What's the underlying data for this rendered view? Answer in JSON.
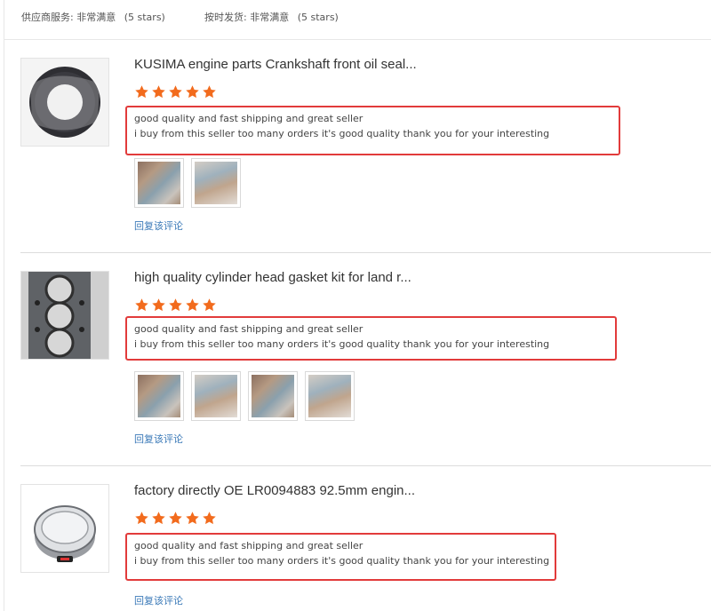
{
  "ratings": {
    "supplier_service_label": "供应商服务:",
    "supplier_service_value": "非常满意",
    "supplier_service_stars": "(5 stars)",
    "ship_on_time_label": "按时发货:",
    "ship_on_time_value": "非常满意",
    "ship_on_time_stars": "(5 stars)"
  },
  "colors": {
    "star": "#f26b1d",
    "highlight_border": "#e23b3b",
    "reply_link": "#3b7ab8"
  },
  "reviews": [
    {
      "title": "KUSIMA engine parts Crankshaft front oil seal...",
      "rating": 5,
      "comment_line1": "good quality and fast shipping and great seller",
      "comment_line2": "i buy from this seller too many orders it's good quality thank you for your interesting",
      "photo_count": 2,
      "reply_label": "回复该评论",
      "product_image": "oil-seal-image"
    },
    {
      "title": "high quality cylinder head gasket kit for land r...",
      "rating": 5,
      "comment_line1": "good quality and fast shipping and great seller",
      "comment_line2": "i buy from this seller too many orders it's good quality thank you for your interesting",
      "photo_count": 4,
      "reply_label": "回复该评论",
      "product_image": "head-gasket-image"
    },
    {
      "title": "factory directly OE LR0094883 92.5mm engin...",
      "rating": 5,
      "comment_line1": "good quality and fast shipping and great seller",
      "comment_line2": "i buy from this seller too many orders it's good quality thank you for your interesting",
      "photo_count": 0,
      "reply_label": "回复该评论",
      "product_image": "piston-image"
    }
  ]
}
